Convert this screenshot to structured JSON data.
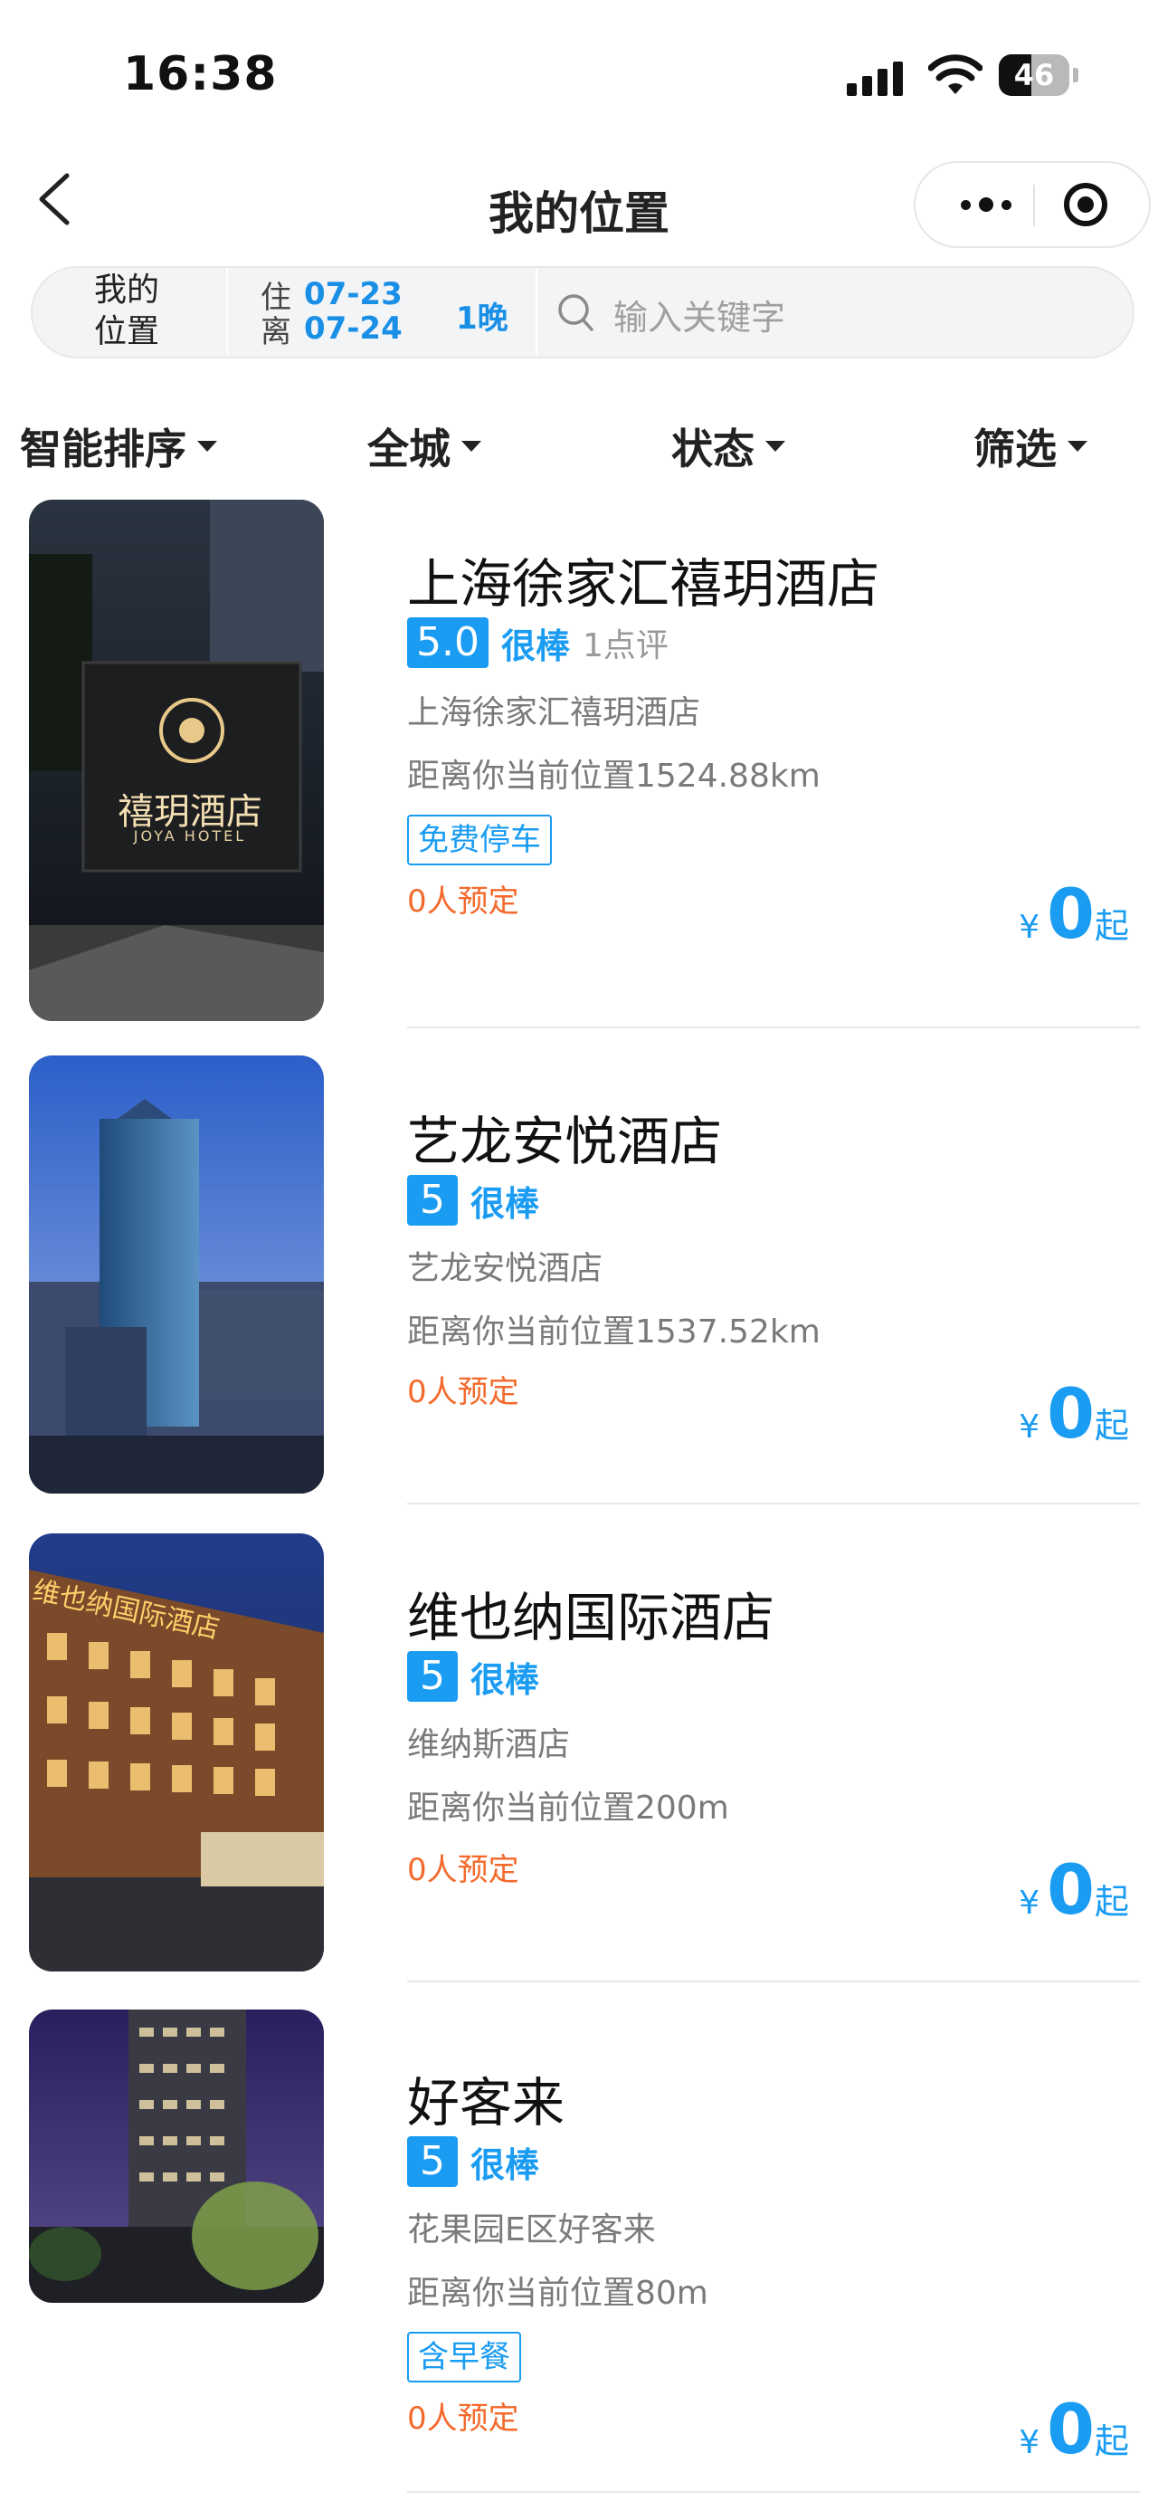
{
  "status_bar": {
    "time": "16:38",
    "battery": "46"
  },
  "nav": {
    "title": "我的位置"
  },
  "search": {
    "location_label": "我的位置",
    "checkin_label": "住",
    "checkin_date": "07-23",
    "checkout_label": "离",
    "checkout_date": "07-24",
    "nights": "1晚",
    "placeholder": "输入关键字"
  },
  "filters": [
    "智能排序",
    "全城",
    "状态",
    "筛选"
  ],
  "hotels": [
    {
      "name": "上海徐家汇禧玥酒店",
      "score": "5.0",
      "rating_word": "很棒",
      "reviews": "1点评",
      "address": "上海徐家汇禧玥酒店",
      "distance": "距离你当前位置1524.88km",
      "tag": "免费停车",
      "booked": "0人预定",
      "price_currency": "¥",
      "price": "0",
      "price_suffix": "起",
      "image_sign_text": "禧玥酒店",
      "image_sign_sub": "JOYA HOTEL"
    },
    {
      "name": "艺龙安悦酒店",
      "score": "5",
      "rating_word": "很棒",
      "address": "艺龙安悦酒店",
      "distance": "距离你当前位置1537.52km",
      "booked": "0人预定",
      "price_currency": "¥",
      "price": "0",
      "price_suffix": "起"
    },
    {
      "name": "维也纳国际酒店",
      "score": "5",
      "rating_word": "很棒",
      "address": "维纳斯酒店",
      "distance": "距离你当前位置200m",
      "booked": "0人预定",
      "price_currency": "¥",
      "price": "0",
      "price_suffix": "起",
      "image_sign_text": "维也纳国际酒店"
    },
    {
      "name": "好客来",
      "score": "5",
      "rating_word": "很棒",
      "address": "花果园E区好客来",
      "distance": "距离你当前位置80m",
      "tag": "含早餐",
      "booked": "0人预定",
      "price_currency": "¥",
      "price": "0",
      "price_suffix": "起"
    }
  ]
}
